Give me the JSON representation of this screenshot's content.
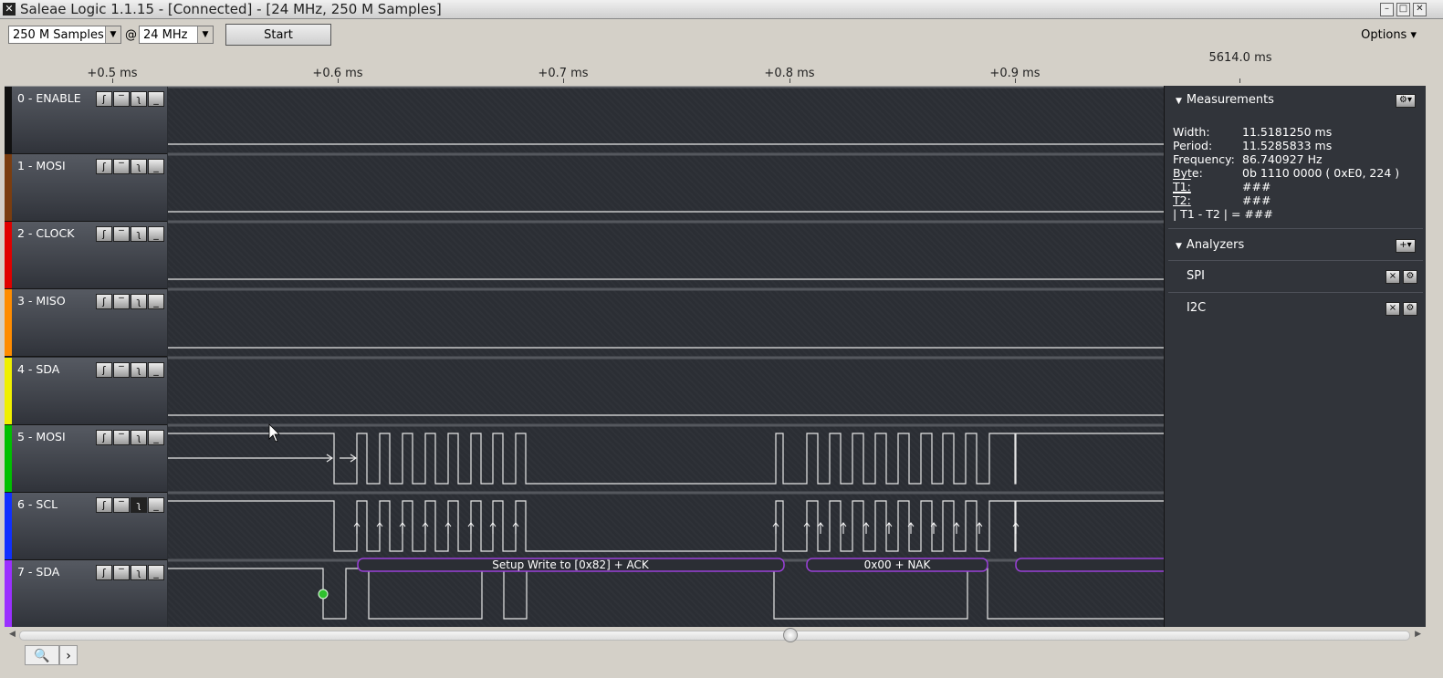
{
  "window": {
    "title": "Saleae Logic 1.1.15 - [Connected] - [24 MHz, 250 M Samples]",
    "buttons": [
      "–",
      "□",
      "✕"
    ]
  },
  "toolbar": {
    "samples": "250 M Samples",
    "at": "@",
    "rate": "24 MHz",
    "start_label": "Start",
    "options_label": "Options ▾"
  },
  "ruler": {
    "ticks": [
      "+0.5 ms",
      "+0.6 ms",
      "+0.7 ms",
      "+0.8 ms",
      "+0.9 ms"
    ],
    "cursor_label": "5614.0 ms"
  },
  "channels": [
    {
      "label": "0 - ENABLE",
      "color": "#111111"
    },
    {
      "label": "1 - MOSI",
      "color": "#7a3d10"
    },
    {
      "label": "2 - CLOCK",
      "color": "#e00000"
    },
    {
      "label": "3 - MISO",
      "color": "#ff8c00"
    },
    {
      "label": "4 - SDA",
      "color": "#f0f000"
    },
    {
      "label": "5 - MOSI",
      "color": "#00c000"
    },
    {
      "label": "6 - SCL",
      "color": "#1030ff"
    },
    {
      "label": "7 - SDA",
      "color": "#9a30ff"
    }
  ],
  "trigger_glyphs": [
    "ʃ",
    "‾",
    "ʅ",
    "_"
  ],
  "decodes": {
    "write": "Setup Write to [0x82] + ACK",
    "data": "0x00 + NAK"
  },
  "measurements": {
    "header": "Measurements",
    "rows": [
      {
        "k": "Width:",
        "v": "11.5181250 ms"
      },
      {
        "k": "Period:",
        "v": "11.5285833 ms"
      },
      {
        "k": "Frequency:",
        "v": "86.740927 Hz"
      },
      {
        "k": "Byte:",
        "v": "0b  1110  0000 ( 0xE0, 224 )"
      },
      {
        "k": "T1:",
        "v": "###"
      },
      {
        "k": "T2:",
        "v": "###"
      }
    ],
    "diff": "| T1 - T2 | = ###"
  },
  "analyzers": {
    "header": "Analyzers",
    "items": [
      "SPI",
      "I2C"
    ]
  },
  "icons": {
    "search": "search-icon",
    "next": "chevron-right-icon"
  }
}
